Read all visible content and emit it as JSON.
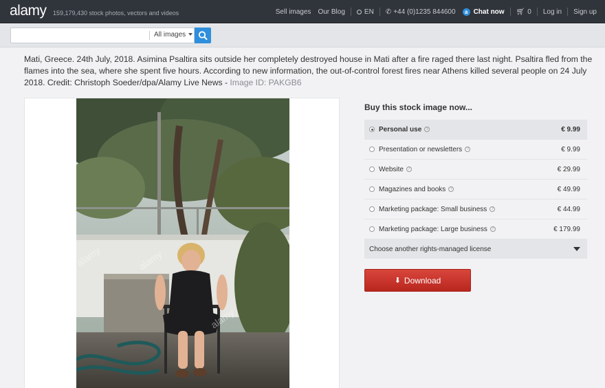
{
  "header": {
    "logo": "alamy",
    "tagline": "159,179,430 stock photos, vectors and videos",
    "nav": {
      "sell": "Sell images",
      "blog": "Our Blog",
      "lang": "EN",
      "phone": "+44 (0)1235 844600",
      "chat": "Chat now",
      "cart_count": "0",
      "login": "Log in",
      "signup": "Sign up"
    }
  },
  "search": {
    "value": "",
    "placeholder": "",
    "scope": "All images"
  },
  "caption": {
    "text": "Mati, Greece. 24th July, 2018. Asimina Psaltira sits outside her completely destroyed house in Mati after a fire raged there last night. Psaltira fled from the flames into the sea, where she spent five hours. According to new information, the out-of-control forest fires near Athens killed several people on 24 July 2018. Credit: Christoph Soeder/dpa/Alamy Live News - ",
    "image_id": "Image ID: PAKGB6"
  },
  "buy": {
    "title": "Buy this stock image now...",
    "licenses": [
      {
        "label": "Personal use",
        "price": "€ 9.99",
        "selected": true
      },
      {
        "label": "Presentation or newsletters",
        "price": "€ 9.99",
        "selected": false
      },
      {
        "label": "Website",
        "price": "€ 29.99",
        "selected": false
      },
      {
        "label": "Magazines and books",
        "price": "€ 49.99",
        "selected": false
      },
      {
        "label": "Marketing package: Small business",
        "price": "€ 44.99",
        "selected": false
      },
      {
        "label": "Marketing package: Large business",
        "price": "€ 179.99",
        "selected": false
      }
    ],
    "another": "Choose another rights-managed license",
    "download": "Download"
  },
  "photo": {
    "watermark": "alamy"
  },
  "colors": {
    "topbar": "#30343b",
    "accent_blue": "#2f8fdc",
    "download_red": "#c9372d"
  }
}
